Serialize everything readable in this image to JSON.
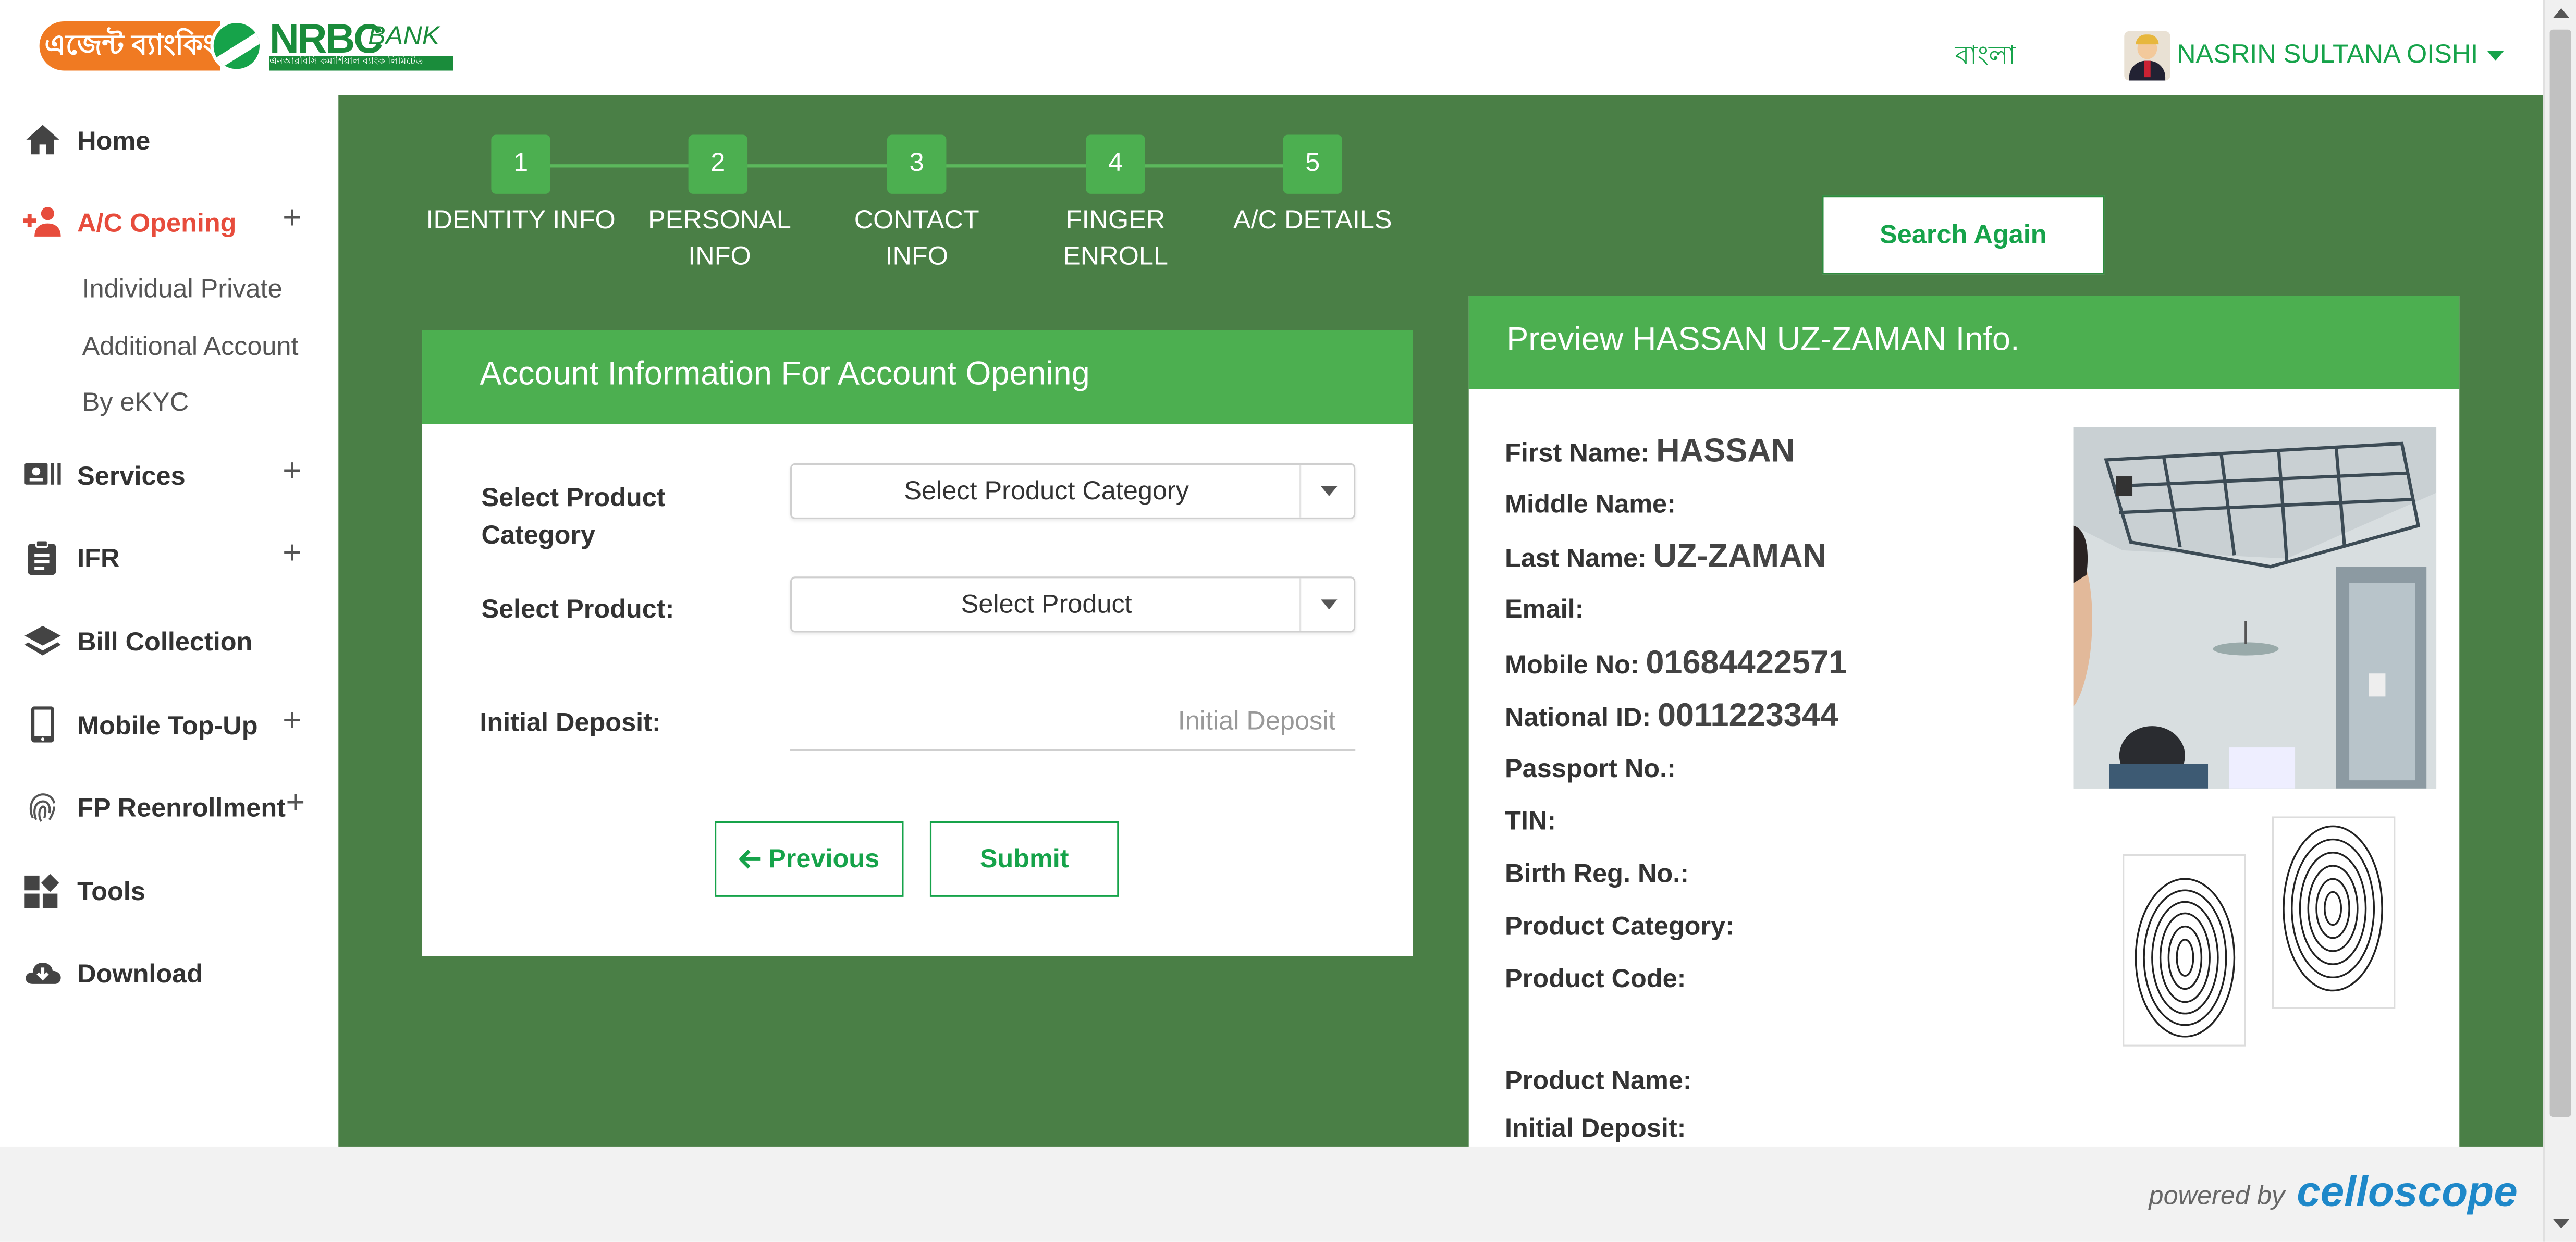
{
  "header": {
    "logo_agent": "এজেন্ট ব্যাংকিং",
    "logo_nrbc": "NRBC",
    "logo_bank": "BANK",
    "logo_sub": "এনআরবিসি কমার্শিয়াল ব্যাংক লিমিটেড",
    "language": "বাংলা",
    "user_name": "NASRIN SULTANA OISHI"
  },
  "sidebar": {
    "home": "Home",
    "ac_opening": "A/C Opening",
    "ac_sub": [
      "Individual Private",
      "Additional Account",
      "By eKYC"
    ],
    "services": "Services",
    "ifr": "IFR",
    "bill_collection": "Bill Collection",
    "mobile_topup": "Mobile Top-Up",
    "fp_reenrollment": "FP Reenrollment",
    "tools": "Tools",
    "download": "Download",
    "plus": "+"
  },
  "steps": [
    {
      "num": "1",
      "label": "IDENTITY INFO"
    },
    {
      "num": "2",
      "label_line1": "PERSONAL",
      "label_line2": "INFO"
    },
    {
      "num": "3",
      "label": "CONTACT INFO"
    },
    {
      "num": "4",
      "label": "FINGER ENROLL"
    },
    {
      "num": "5",
      "label": "A/C DETAILS"
    }
  ],
  "search_again": "Search Again",
  "account_form": {
    "title": "Account Information For Account Opening",
    "product_category_label_1": "Select Product",
    "product_category_label_2": "Category",
    "product_category_value": "Select Product Category",
    "product_label": "Select Product:",
    "product_value": "Select Product",
    "deposit_label": "Initial Deposit:",
    "deposit_placeholder": "Initial Deposit",
    "previous": "Previous",
    "submit": "Submit"
  },
  "preview": {
    "title": "Preview HASSAN UZ-ZAMAN Info.",
    "first_name_label": "First Name:",
    "first_name": "HASSAN",
    "middle_name_label": "Middle Name:",
    "last_name_label": "Last Name:",
    "last_name": "UZ-ZAMAN",
    "email_label": "Email:",
    "mobile_label": "Mobile No:",
    "mobile": "01684422571",
    "nid_label": "National ID:",
    "nid": "0011223344",
    "passport_label": "Passport No.:",
    "tin_label": "TIN:",
    "birth_label": "Birth Reg. No.:",
    "product_category_label": "Product Category:",
    "product_code_label": "Product Code:",
    "product_name_label": "Product Name:",
    "initial_deposit_label": "Initial Deposit:"
  },
  "footer": {
    "powered_by": "powered by",
    "brand": "celloscope"
  }
}
